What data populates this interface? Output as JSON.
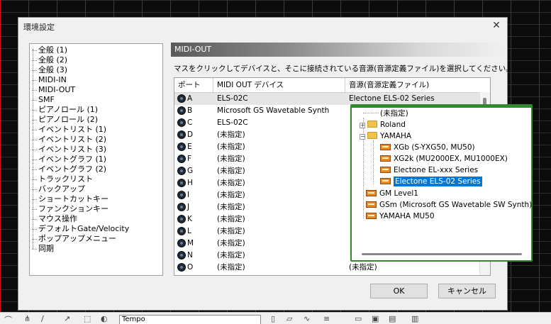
{
  "dialog": {
    "title": "環境設定",
    "close": "✕"
  },
  "tree": {
    "items": [
      "全般 (1)",
      "全般 (2)",
      "全般 (3)",
      "MIDI-IN",
      "MIDI-OUT",
      "SMF",
      "ピアノロール (1)",
      "ピアノロール (2)",
      "イベントリスト (1)",
      "イベントリスト (2)",
      "イベントリスト (3)",
      "イベントグラフ (1)",
      "イベントグラフ (2)",
      "トラックリスト",
      "バックアップ",
      "ショートカットキー",
      "ファンクションキー",
      "マウス操作",
      "デフォルトGate/Velocity",
      "ポップアップメニュー",
      "同期"
    ]
  },
  "panel": {
    "header": "MIDI-OUT",
    "instruction": "マスをクリックしてデバイスと、そこに接続されている音源(音源定義ファイル)を選択してください。",
    "columns": {
      "port": "ポート",
      "device": "MIDI OUT デバイス",
      "source": "音源(音源定義ファイル)"
    },
    "rows": [
      {
        "port": "A",
        "device": "ELS-02C",
        "source": "Electone ELS-02 Series"
      },
      {
        "port": "B",
        "device": "Microsoft GS Wavetable Synth",
        "source": ""
      },
      {
        "port": "C",
        "device": "ELS-02C",
        "source": ""
      },
      {
        "port": "D",
        "device": "(未指定)",
        "source": ""
      },
      {
        "port": "E",
        "device": "(未指定)",
        "source": ""
      },
      {
        "port": "F",
        "device": "(未指定)",
        "source": ""
      },
      {
        "port": "G",
        "device": "(未指定)",
        "source": ""
      },
      {
        "port": "H",
        "device": "(未指定)",
        "source": ""
      },
      {
        "port": "I",
        "device": "(未指定)",
        "source": ""
      },
      {
        "port": "J",
        "device": "(未指定)",
        "source": ""
      },
      {
        "port": "K",
        "device": "(未指定)",
        "source": ""
      },
      {
        "port": "L",
        "device": "(未指定)",
        "source": ""
      },
      {
        "port": "M",
        "device": "(未指定)",
        "source": ""
      },
      {
        "port": "N",
        "device": "(未指定)",
        "source": ""
      },
      {
        "port": "O",
        "device": "(未指定)",
        "source": "(未指定)"
      }
    ]
  },
  "popup": {
    "unspecified": "(未指定)",
    "roland": "Roland",
    "yamaha": "YAMAHA",
    "yamaha_children": [
      "XGb (S-YXG50, MU50)",
      "XG2k (MU2000EX, MU1000EX)",
      "Electone EL-xxx Series",
      "Electone ELS-02 Series"
    ],
    "others": [
      "GM Level1",
      "GSm (Microsoft GS Wavetable SW Synth)",
      "YAMAHA MU50"
    ],
    "plus": "+",
    "minus": "−"
  },
  "buttons": {
    "ok": "OK",
    "cancel": "キャンセル"
  },
  "bottom_toolbar": {
    "select_value": "Tempo"
  },
  "colors": {
    "popup_border": "#2e8b2e",
    "selection": "#0078d7"
  }
}
